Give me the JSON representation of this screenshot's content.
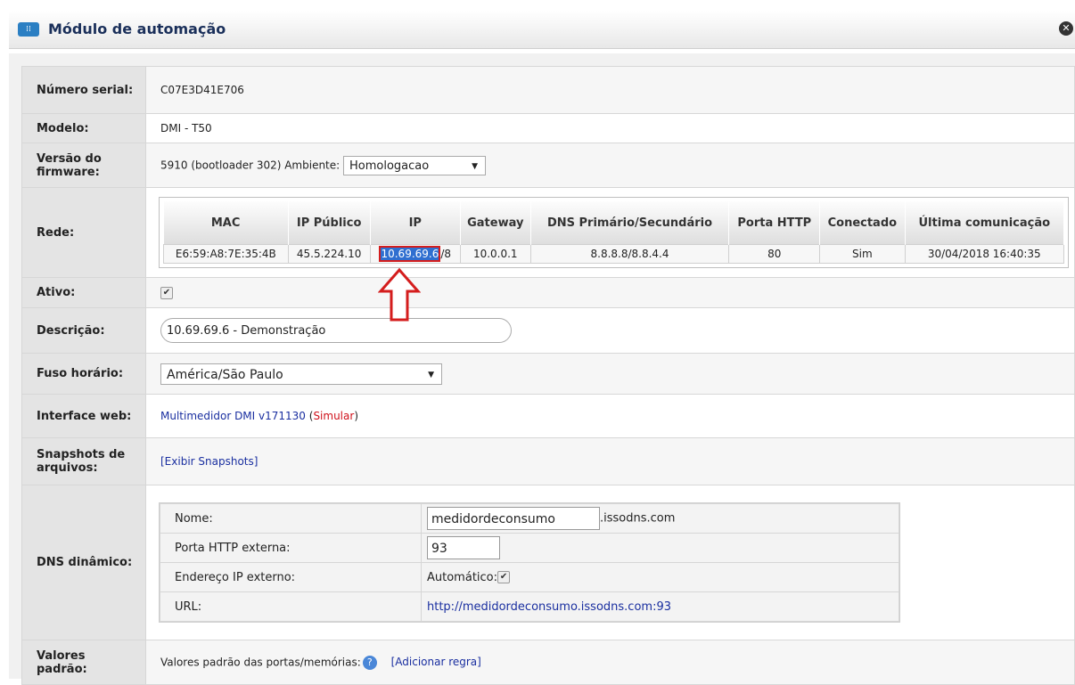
{
  "window": {
    "title": "Módulo de automação",
    "title_icon": "grid-icon",
    "close_icon": "close-icon"
  },
  "serial": {
    "label": "Número serial:",
    "value": "C07E3D41E706"
  },
  "model": {
    "label": "Modelo:",
    "value": "DMI - T50"
  },
  "firmware": {
    "label": "Versão do firmware:",
    "value": "5910 (bootloader 302) Ambiente:",
    "environment": "Homologacao"
  },
  "network": {
    "label": "Rede:",
    "headers": [
      "MAC",
      "IP Público",
      "IP",
      "Gateway",
      "DNS Primário/Secundário",
      "Porta HTTP",
      "Conectado",
      "Última comunicação"
    ],
    "row": {
      "mac": "E6:59:A8:7E:35:4B",
      "public_ip": "45.5.224.10",
      "ip_selected": "10.69.69.6",
      "ip_suffix": "/8",
      "gateway": "10.0.0.1",
      "dns": "8.8.8.8/8.8.4.4",
      "http_port": "80",
      "connected": "Sim",
      "last_comm": "30/04/2018 16:40:35"
    }
  },
  "active": {
    "label": "Ativo:",
    "checked": true
  },
  "description": {
    "label": "Descrição:",
    "value": "10.69.69.6 - Demonstração"
  },
  "timezone": {
    "label": "Fuso horário:",
    "value": "América/São Paulo"
  },
  "web_interface": {
    "label": "Interface web:",
    "link": "Multimedidor DMI v171130",
    "open": "(",
    "simulate": "Simular",
    "close": ")"
  },
  "snapshots": {
    "label": "Snapshots de arquivos:",
    "link": "[Exibir Snapshots]"
  },
  "dyndns": {
    "label": "DNS dinâmico:",
    "name_label": "Nome:",
    "name_value": "medidordeconsumo",
    "name_suffix": ".issodns.com",
    "port_label": "Porta HTTP externa:",
    "port_value": "93",
    "ext_ip_label": "Endereço IP externo:",
    "ext_ip_value": "Automático:",
    "url_label": "URL:",
    "url_value": "http://medidordeconsumo.issodns.com:93"
  },
  "defaults": {
    "label": "Valores padrão:",
    "text": "Valores padrão das portas/memórias:",
    "link": "[Adicionar regra]"
  },
  "colors": {
    "highlight": "#2f6fd0",
    "annotation": "#d41d1d",
    "link": "#1a2fa0"
  }
}
